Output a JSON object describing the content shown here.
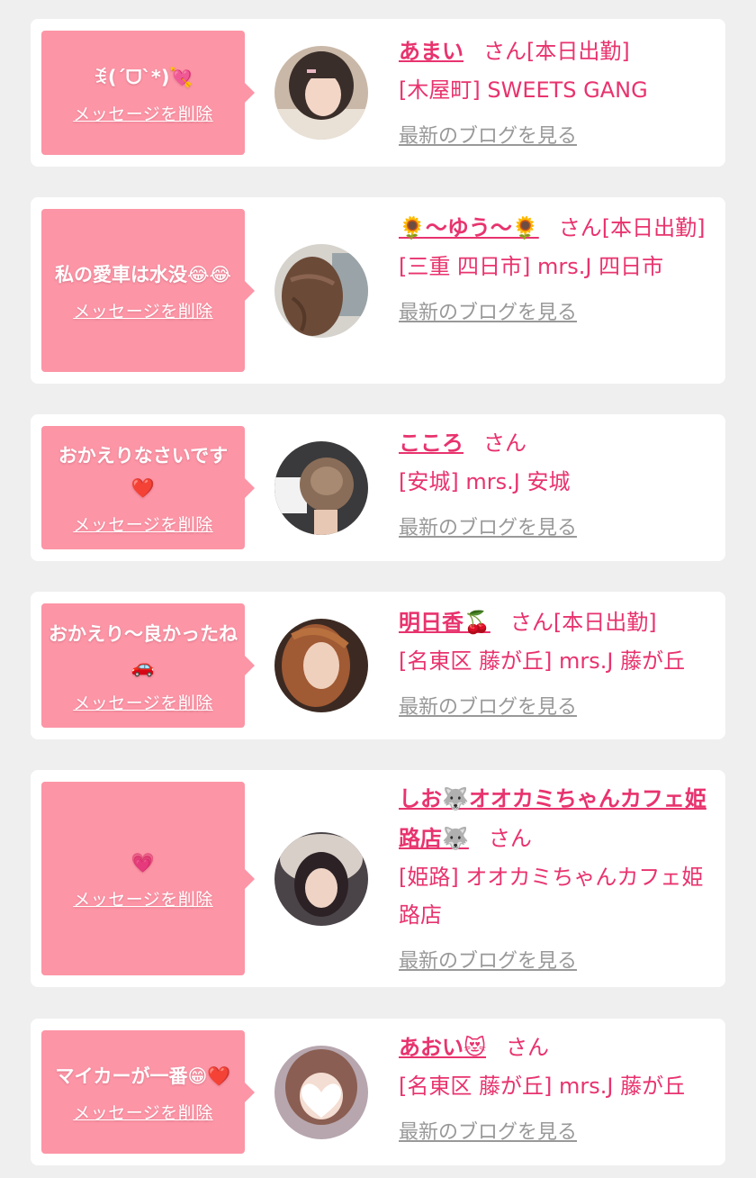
{
  "delete_label": "メッセージを削除",
  "blog_label": "最新のブログを見る",
  "san_label": "さん",
  "colors": {
    "background": "#efefef",
    "bubble": "#fc95a6",
    "accent": "#e8336e",
    "link_gray": "#999999"
  },
  "items": [
    {
      "message": "ꉂ(ˊᗜˋ*)💘",
      "name": "あまい",
      "status": "[本日出勤]",
      "shop": "[木屋町] SWEETS GANG",
      "avatar_icon": "avatar-photo"
    },
    {
      "message": "私の愛車は水没😂😂",
      "name": "🌻〜ゆう〜🌻",
      "status": "[本日出勤]",
      "shop": "[三重 四日市] mrs.J 四日市",
      "avatar_icon": "avatar-photo"
    },
    {
      "message": "おかえりなさいです❤️",
      "name": "こころ",
      "status": "",
      "shop": "[安城] mrs.J 安城",
      "avatar_icon": "avatar-photo"
    },
    {
      "message": "おかえり〜良かったね🚗",
      "name": "明日香🍒",
      "status": "[本日出勤]",
      "shop": "[名東区 藤が丘] mrs.J 藤が丘",
      "avatar_icon": "avatar-photo"
    },
    {
      "message": "💗",
      "name": "しお🐺オオカミちゃんカフェ姫路店🐺",
      "status": "",
      "shop": "[姫路] オオカミちゃんカフェ姫路店",
      "avatar_icon": "avatar-photo"
    },
    {
      "message": "マイカーが一番😁❤️",
      "name": "あおい😻",
      "status": "",
      "shop": "[名東区 藤が丘] mrs.J 藤が丘",
      "avatar_icon": "avatar-photo"
    }
  ]
}
